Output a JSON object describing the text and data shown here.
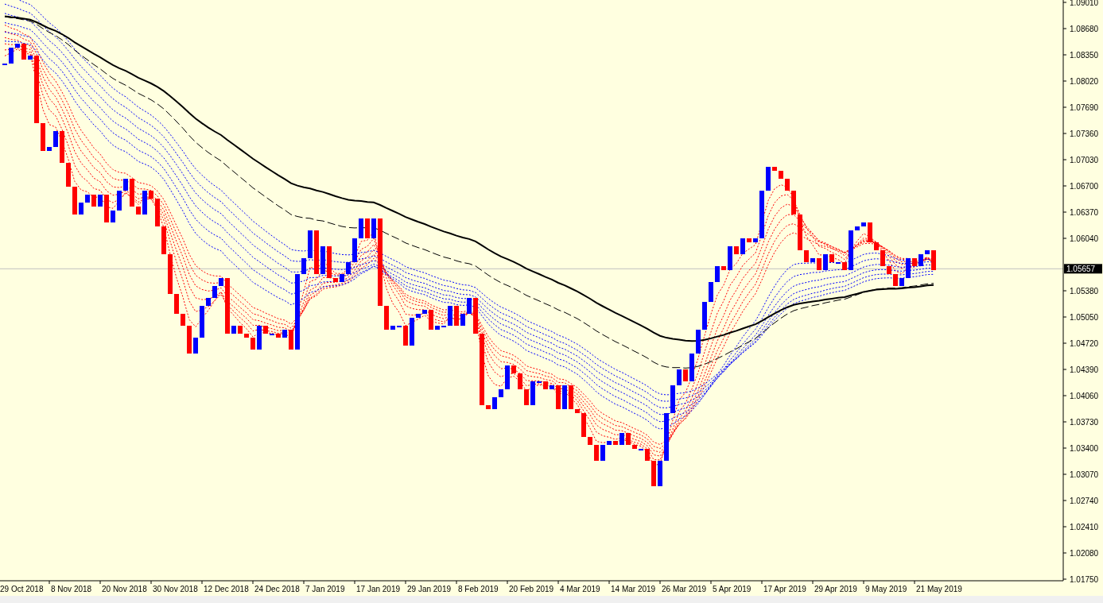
{
  "price_axis": {
    "labels": [
      "1.09010",
      "1.08680",
      "1.08350",
      "1.08020",
      "1.07690",
      "1.07360",
      "1.07030",
      "1.06700",
      "1.06370",
      "1.06040",
      "1.05380",
      "1.05050",
      "1.04720",
      "1.04390",
      "1.04060",
      "1.03730",
      "1.03400",
      "1.03070",
      "1.02740",
      "1.02410",
      "1.02080",
      "1.01750"
    ],
    "current_price": "1.05657"
  },
  "date_axis": {
    "labels": [
      "29 Oct 2018",
      "8 Nov 2018",
      "20 Nov 2018",
      "30 Nov 2018",
      "12 Dec 2018",
      "24 Dec 2018",
      "7 Jan 2019",
      "17 Jan 2019",
      "29 Jan 2019",
      "8 Feb 2019",
      "20 Feb 2019",
      "4 Mar 2019",
      "14 Mar 2019",
      "26 Mar 2019",
      "5 Apr 2019",
      "17 Apr 2019",
      "29 Apr 2019",
      "9 May 2019",
      "21 May 2019"
    ]
  }
}
